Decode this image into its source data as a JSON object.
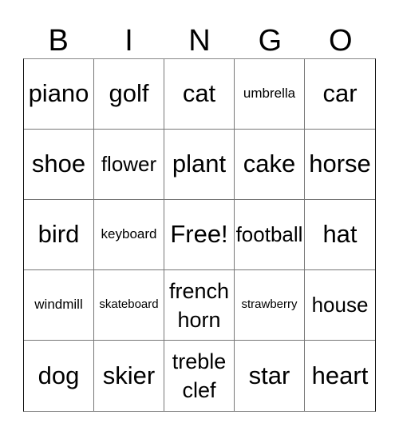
{
  "header": {
    "letters": [
      "B",
      "I",
      "N",
      "G",
      "O"
    ]
  },
  "card": {
    "rows": [
      [
        "piano",
        "golf",
        "cat",
        "umbrella",
        "car"
      ],
      [
        "shoe",
        "flower",
        "plant",
        "cake",
        "horse"
      ],
      [
        "bird",
        "keyboard",
        "Free!",
        "football",
        "hat"
      ],
      [
        "windmill",
        "skateboard",
        "french horn",
        "strawberry",
        "house"
      ],
      [
        "dog",
        "skier",
        "treble clef",
        "star",
        "heart"
      ]
    ]
  }
}
